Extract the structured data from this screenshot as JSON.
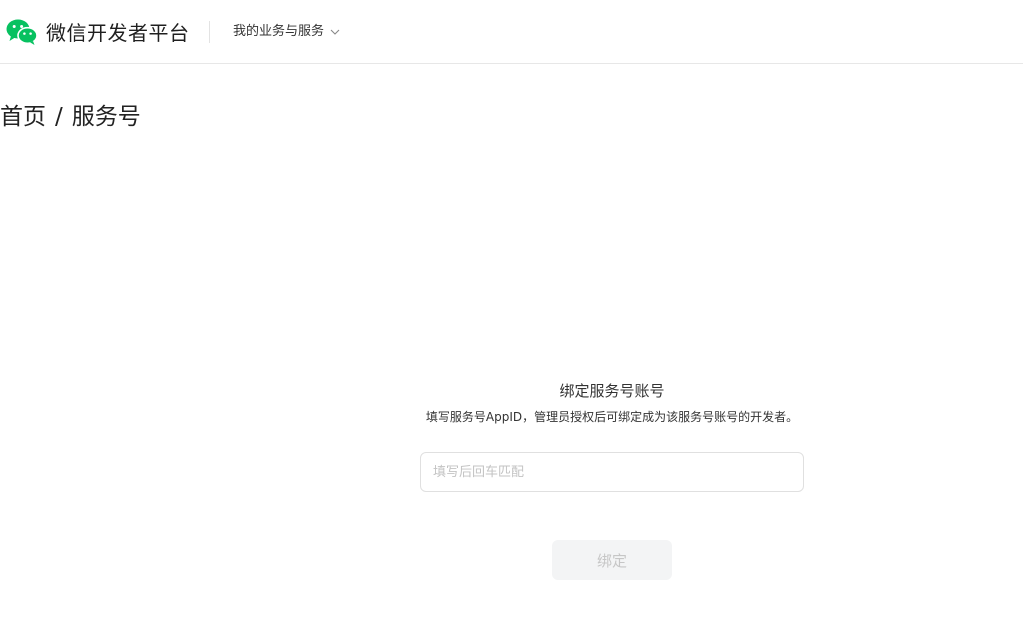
{
  "header": {
    "logo_icon": "wechat-icon",
    "brand_color": "#07c160",
    "brand_title": "微信开发者平台",
    "menu_label": "我的业务与服务",
    "menu_icon": "chevron-down-icon"
  },
  "breadcrumb": {
    "items": [
      "首页",
      "服务号"
    ],
    "separator": "/"
  },
  "bind_panel": {
    "title": "绑定服务号账号",
    "description": "填写服务号AppID，管理员授权后可绑定成为该服务号账号的开发者。",
    "input_placeholder": "填写后回车匹配",
    "input_value": "",
    "button_label": "绑定",
    "button_disabled": true
  }
}
